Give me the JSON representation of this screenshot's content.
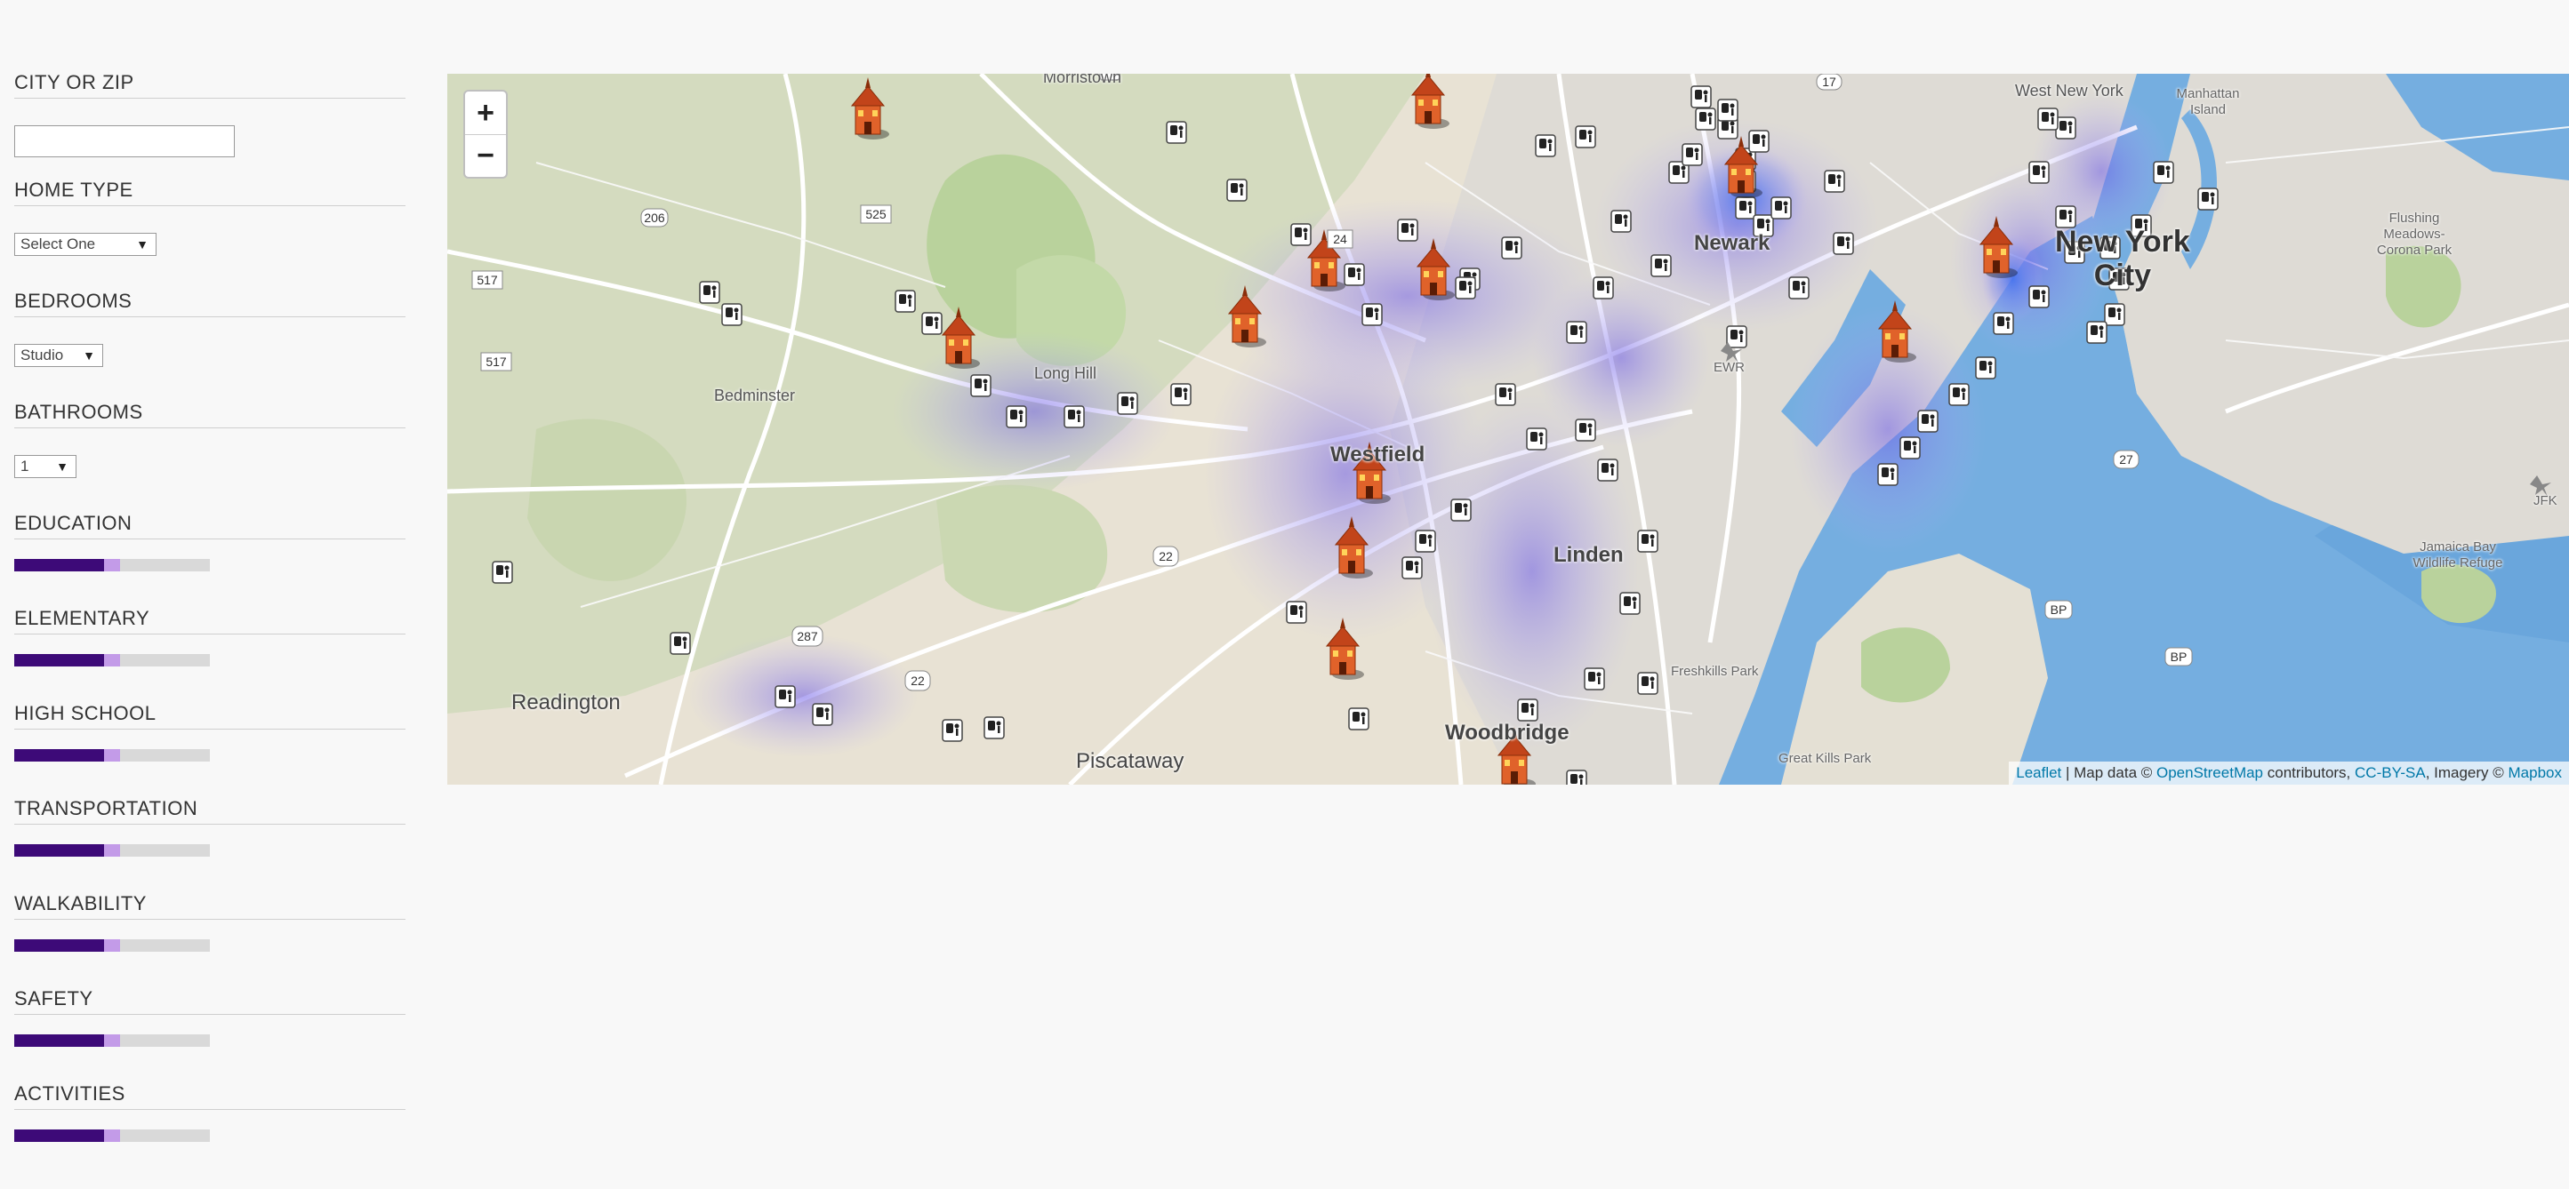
{
  "sidebar": {
    "city_label": "CITY OR ZIP",
    "city_value": "",
    "home_type_label": "HOME TYPE",
    "home_type_value": "Select One",
    "bedrooms_label": "BEDROOMS",
    "bedrooms_value": "Studio",
    "bathrooms_label": "BATHROOMS",
    "bathrooms_value": "1",
    "sliders": [
      {
        "label": "EDUCATION",
        "level": 0.54,
        "dark_level": 0.46
      },
      {
        "label": "ELEMENTARY",
        "level": 0.54,
        "dark_level": 0.46
      },
      {
        "label": "HIGH SCHOOL",
        "level": 0.54,
        "dark_level": 0.46
      },
      {
        "label": "TRANSPORTATION",
        "level": 0.54,
        "dark_level": 0.46
      },
      {
        "label": "WALKABILITY",
        "level": 0.54,
        "dark_level": 0.46
      },
      {
        "label": "SAFETY",
        "level": 0.54,
        "dark_level": 0.46
      },
      {
        "label": "ACTIVITIES",
        "level": 0.54,
        "dark_level": 0.46
      }
    ],
    "colors": {
      "slider_dark": "#3d0a78",
      "slider_light": "#c39be8",
      "slider_track": "#d9d9d9"
    }
  },
  "map": {
    "zoom_in": "+",
    "zoom_out": "−",
    "attribution": {
      "leaflet": "Leaflet",
      "mid1": " | Map data © ",
      "osm": "OpenStreetMap",
      "mid2": " contributors, ",
      "license": "CC-BY-SA",
      "mid3": ", Imagery © ",
      "mapbox": "Mapbox"
    },
    "places": {
      "nyc_line1": "New York",
      "nyc_line2": "City",
      "newark": "Newark",
      "linden": "Linden",
      "westfield": "Westfield",
      "woodbridge": "Woodbridge",
      "piscataway": "Piscataway",
      "readington": "Readington",
      "long_hill": "Long Hill",
      "bedminster": "Bedminster",
      "morristown": "Morristown",
      "west_new_york": "West New York",
      "manhattan_island": "Manhattan Island",
      "flushing": "Flushing Meadows-Corona Park",
      "jamaica_bay": "Jamaica Bay Wildlife Refuge",
      "freshkills": "Freshkills Park",
      "great_kills": "Great Kills Park",
      "ewr": "EWR",
      "jfk": "JFK"
    },
    "route_shields": [
      "206",
      "525",
      "517",
      "517",
      "24",
      "287",
      "22",
      "22",
      "27",
      "17",
      "BP",
      "BP"
    ],
    "colors": {
      "land": "#e8e2d4",
      "water": "#75aee0",
      "park": "#b9d7a0",
      "heat": "#8a7fe8"
    }
  }
}
